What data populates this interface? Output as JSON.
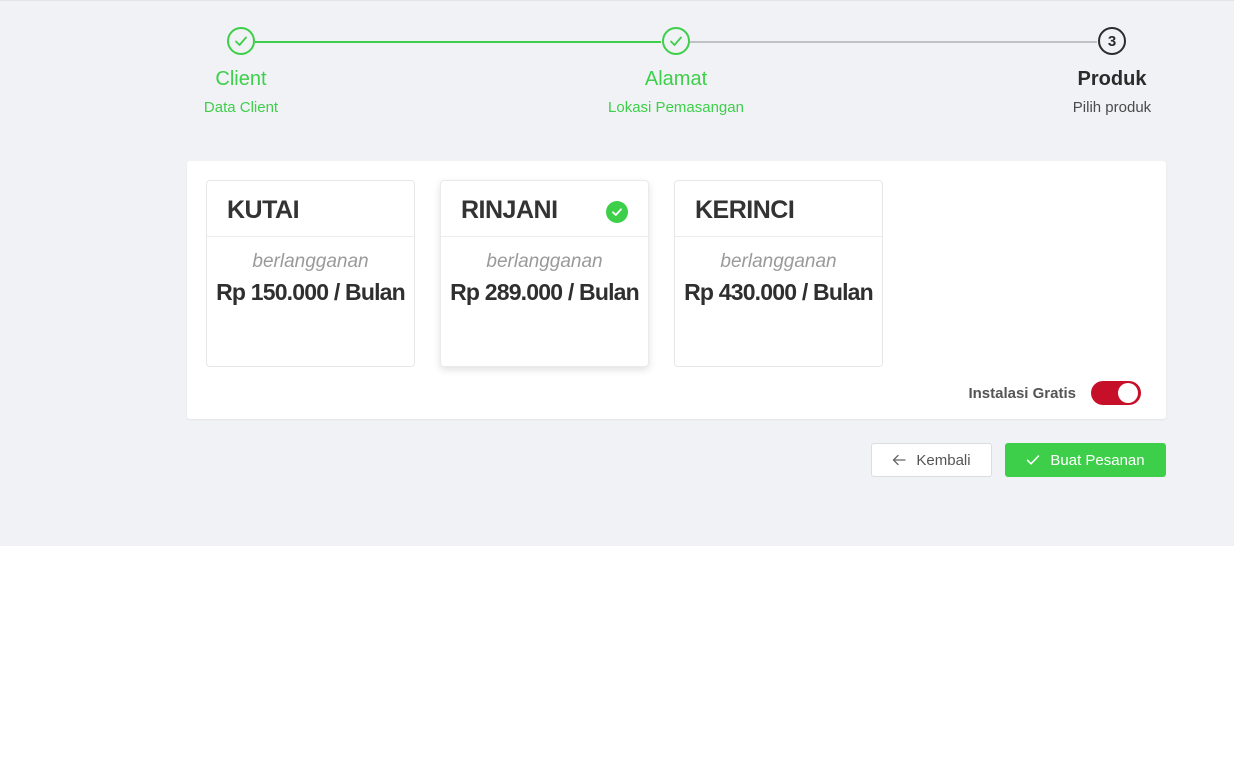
{
  "steps": [
    {
      "title": "Client",
      "desc": "Data Client",
      "status": "done"
    },
    {
      "title": "Alamat",
      "desc": "Lokasi Pemasangan",
      "status": "done"
    },
    {
      "title": "Produk",
      "desc": "Pilih produk",
      "status": "active",
      "number": "3"
    }
  ],
  "products": [
    {
      "name": "KUTAI",
      "subtitle": "berlangganan",
      "price": "Rp 150.000 / Bulan",
      "selected": false
    },
    {
      "name": "RINJANI",
      "subtitle": "berlangganan",
      "price": "Rp 289.000 / Bulan",
      "selected": true
    },
    {
      "name": "KERINCI",
      "subtitle": "berlangganan",
      "price": "Rp 430.000 / Bulan",
      "selected": false
    }
  ],
  "options": {
    "free_install_label": "Instalasi Gratis",
    "free_install_on": true
  },
  "buttons": {
    "back_label": "Kembali",
    "order_label": "Buat Pesanan"
  },
  "colors": {
    "success": "#3ecf4a",
    "toggle_on": "#c6102a",
    "background": "#f0f2f5"
  },
  "icons": {
    "step_done": "check-icon",
    "product_selected": "check-circle-icon",
    "back": "arrow-left-icon",
    "order": "check-icon"
  }
}
